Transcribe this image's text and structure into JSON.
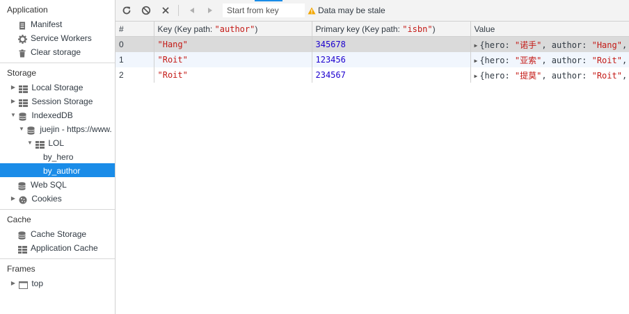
{
  "sidebar": {
    "application": {
      "title": "Application",
      "items": [
        {
          "label": "Manifest"
        },
        {
          "label": "Service Workers"
        },
        {
          "label": "Clear storage"
        }
      ]
    },
    "storage": {
      "title": "Storage",
      "local_storage": "Local Storage",
      "session_storage": "Session Storage",
      "indexeddb": "IndexedDB",
      "db": "juejin - https://www.",
      "store": "LOL",
      "index1": "by_hero",
      "index2": "by_author",
      "web_sql": "Web SQL",
      "cookies": "Cookies"
    },
    "cache": {
      "title": "Cache",
      "cache_storage": "Cache Storage",
      "app_cache": "Application Cache"
    },
    "frames": {
      "title": "Frames",
      "top": "top"
    }
  },
  "toolbar": {
    "key_placeholder": "Start from key",
    "stale_text": "Data may be stale",
    "warning_color": "#f2a600"
  },
  "table": {
    "headers": {
      "index": "#",
      "key_prefix": "Key (Key path: ",
      "key_path": "\"author\"",
      "pk_prefix": "Primary key (Key path: ",
      "pk_path": "\"isbn\"",
      "suffix": ")",
      "value": "Value"
    },
    "rows": [
      {
        "index": "0",
        "key": "\"Hang\"",
        "primary": "345678",
        "v1": "{hero: ",
        "hero": "\"诺手\"",
        "v2": ", author: ",
        "author": "\"Hang\"",
        "v3": ","
      },
      {
        "index": "1",
        "key": "\"Roit\"",
        "primary": "123456",
        "v1": "{hero: ",
        "hero": "\"亚索\"",
        "v2": ", author: ",
        "author": "\"Roit\"",
        "v3": ","
      },
      {
        "index": "2",
        "key": "\"Roit\"",
        "primary": "234567",
        "v1": "{hero: ",
        "hero": "\"提莫\"",
        "v2": ", author: ",
        "author": "\"Roit\"",
        "v3": ","
      }
    ]
  }
}
